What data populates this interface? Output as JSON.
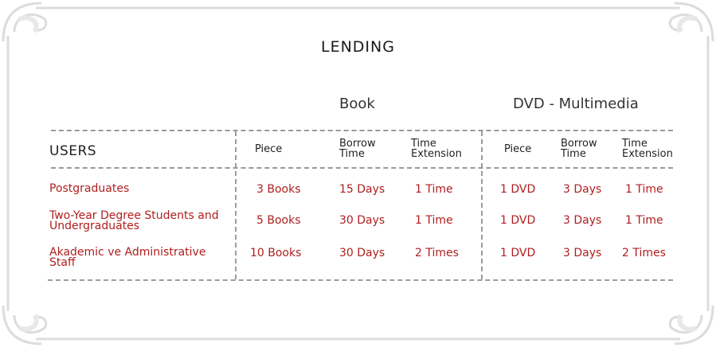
{
  "title": "LENDING",
  "groups": {
    "book": "Book",
    "dvd": "DVD - Multimedia"
  },
  "columns": {
    "users": "USERS",
    "book_piece": "Piece",
    "book_borrow_1": "Borrow",
    "book_borrow_2": "Time",
    "book_ext_1": "Time",
    "book_ext_2": "Extension",
    "dvd_piece": "Piece",
    "dvd_borrow_1": "Borrow",
    "dvd_borrow_2": "Time",
    "dvd_ext_1": "Time",
    "dvd_ext_2": "Extension"
  },
  "rows": [
    {
      "user_1": "Postgraduates",
      "user_2": "",
      "book_piece": "3 Books",
      "book_borrow": "15 Days",
      "book_ext": "1 Time",
      "dvd_piece": "1 DVD",
      "dvd_borrow": "3 Days",
      "dvd_ext": "1 Time"
    },
    {
      "user_1": "Two-Year Degree Students and",
      "user_2": "Undergraduates",
      "book_piece": "5 Books",
      "book_borrow": "30 Days",
      "book_ext": "1 Time",
      "dvd_piece": "1 DVD",
      "dvd_borrow": "3 Days",
      "dvd_ext": "1 Time"
    },
    {
      "user_1": "Akademic ve Administrative",
      "user_2": "Staff",
      "book_piece": "10 Books",
      "book_borrow": "30 Days",
      "book_ext": "2 Times",
      "dvd_piece": "1 DVD",
      "dvd_borrow": "3 Days",
      "dvd_ext": "2 Times"
    }
  ],
  "colors": {
    "value_text": "#b01e1e",
    "rule": "#9a9a9a",
    "frame": "#dcdcdc"
  }
}
